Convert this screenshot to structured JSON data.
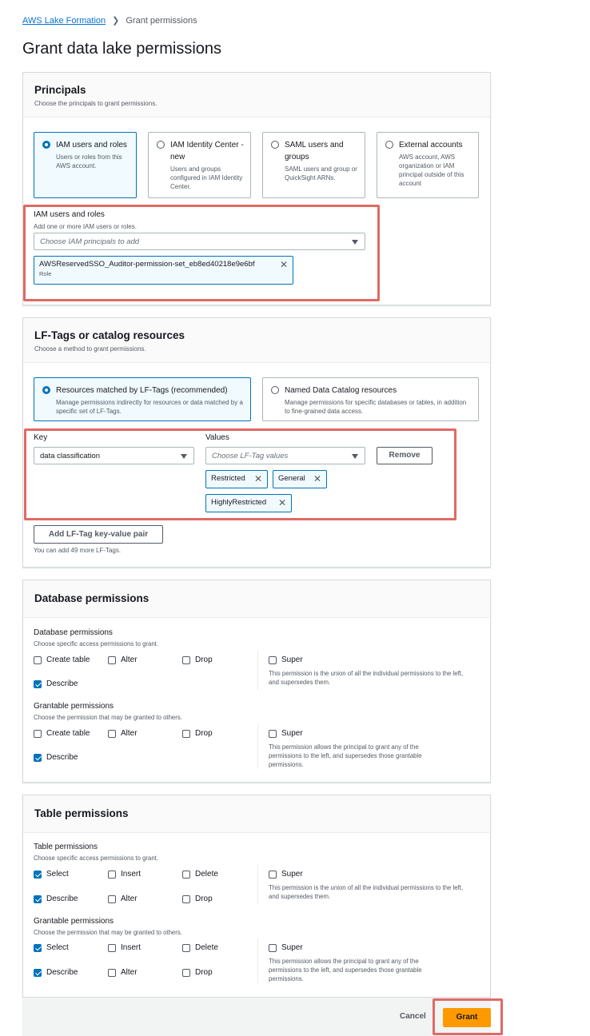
{
  "breadcrumb": {
    "root": "AWS Lake Formation",
    "current": "Grant permissions"
  },
  "page_title": "Grant data lake permissions",
  "principals": {
    "title": "Principals",
    "desc": "Choose the principals to grant permissions.",
    "options": [
      {
        "title": "IAM users and roles",
        "desc": "Users or roles from this AWS account.",
        "selected": true
      },
      {
        "title": "IAM Identity Center - new",
        "desc": "Users and groups configured in IAM Identity Center.",
        "selected": false
      },
      {
        "title": "SAML users and groups",
        "desc": "SAML users and group or QuickSight ARNs.",
        "selected": false
      },
      {
        "title": "External accounts",
        "desc": "AWS account, AWS organization or IAM principal outside of this account",
        "selected": false
      }
    ],
    "iam_label": "IAM users and roles",
    "iam_desc": "Add one or more IAM users or roles.",
    "iam_placeholder": "Choose IAM principals to add",
    "token_name": "AWSReservedSSO_Auditor-permission-set_eb8ed40218e9e6bf",
    "token_sub": "Role"
  },
  "lftags": {
    "title": "LF-Tags or catalog resources",
    "desc": "Choose a method to grant permissions.",
    "options": [
      {
        "title": "Resources matched by LF-Tags (recommended)",
        "desc": "Manage permissions indirectly for resources or data matched by a specific set of LF-Tags.",
        "selected": true
      },
      {
        "title": "Named Data Catalog resources",
        "desc": "Manage permissions for specific databases or tables, in addition to fine-grained data access.",
        "selected": false
      }
    ],
    "key_label": "Key",
    "key_value": "data classification",
    "values_label": "Values",
    "values_placeholder": "Choose LF-Tag values",
    "remove_label": "Remove",
    "tokens": [
      "Restricted",
      "General",
      "HighlyRestricted"
    ],
    "add_pair_label": "Add LF-Tag key-value pair",
    "add_hint": "You can add 49 more LF-Tags."
  },
  "database": {
    "title": "Database permissions",
    "perm_head": "Database permissions",
    "perm_desc": "Choose specific access permissions to grant.",
    "grant_head": "Grantable permissions",
    "grant_desc": "Choose the permission that may be granted to others.",
    "labels": {
      "create": "Create table",
      "alter": "Alter",
      "drop": "Drop",
      "describe": "Describe",
      "super": "Super"
    },
    "super_desc": "This permission is the union of all the individual permissions to the left, and supersedes them.",
    "super_grant_desc": "This permission allows the principal to grant any of the permissions to the left, and supersedes those grantable permissions."
  },
  "table": {
    "title": "Table permissions",
    "perm_head": "Table permissions",
    "perm_desc": "Choose specific access permissions to grant.",
    "grant_head": "Grantable permissions",
    "grant_desc": "Choose the permission that may be granted to others.",
    "labels": {
      "select": "Select",
      "insert": "Insert",
      "delete": "Delete",
      "describe": "Describe",
      "alter": "Alter",
      "drop": "Drop",
      "super": "Super"
    },
    "super_desc": "This permission is the union of all the individual permissions to the left, and supersedes them.",
    "super_grant_desc": "This permission allows the principal to grant any of the permissions to the left, and supersedes those grantable permissions."
  },
  "footer": {
    "cancel": "Cancel",
    "grant": "Grant"
  },
  "colors": {
    "accent": "#0073bb",
    "primary_button": "#ff9900",
    "highlight": "#e06a63"
  }
}
